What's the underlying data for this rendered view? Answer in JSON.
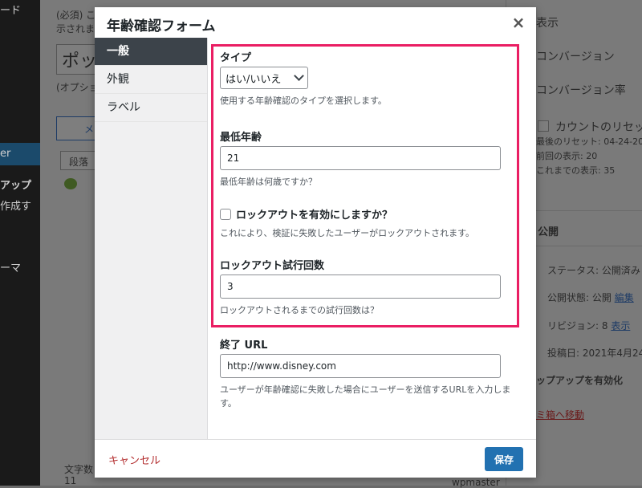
{
  "background": {
    "sidebar": {
      "text_top": "ード",
      "item_active": "er",
      "item_popup": "アップ",
      "item_create": "作成す",
      "item_theme": "ーマ"
    },
    "main": {
      "required_note": "(必須) こ",
      "required_note2": "示されま",
      "title_input_partial": "ポッ",
      "optional_note": "(オプショ",
      "media_button": "メ",
      "paragraph_label": "段落",
      "word_count_label": "文字数",
      "word_count_value": "11",
      "author": "wpmaster"
    },
    "right_panel": {
      "display": "表示",
      "conversion": "コンバージョン",
      "conversion_rate": "コンバージョン率",
      "reset_count": "カウントのリセッ",
      "last_reset": "最後のリセット: 04-24-20",
      "previous_display": "前回の表示: 20",
      "total_display": "これまでの表示: 35",
      "publish": "公開",
      "status": "ステータス: 公開済み",
      "visibility_label": "公開状態: 公開",
      "edit_link": "編集",
      "revision": "リビジョン: 8",
      "revision_link": "表示",
      "post_date": "投稿日: 2021年4月24",
      "enable_popup": "ップアップを有効化",
      "trash_link": "ミ箱へ移動"
    }
  },
  "modal": {
    "title": "年齢確認フォーム",
    "close_glyph": "×",
    "nav": [
      "一般",
      "外観",
      "ラベル"
    ],
    "fields": {
      "type": {
        "label": "タイプ",
        "selected": "はい/いいえ",
        "help": "使用する年齢確認のタイプを選択します。"
      },
      "min_age": {
        "label": "最低年齢",
        "value": "21",
        "help": "最低年齢は何歳ですか？"
      },
      "lockout": {
        "label": "ロックアウトを有効にしますか？",
        "checked": false,
        "help": "これにより、検証に失敗したユーザーがロックアウトされます。"
      },
      "lockout_attempts": {
        "label": "ロックアウト試行回数",
        "value": "3",
        "help": "ロックアウトされるまでの試行回数は？"
      },
      "end_url": {
        "label": "終了 URL",
        "value": "http://www.disney.com",
        "help": "ユーザーが年齢確認に失敗した場合にユーザーを送信するURLを入力します。"
      }
    },
    "footer": {
      "cancel": "キャンセル",
      "save": "保存"
    }
  },
  "colors": {
    "highlight": "#ea1e63",
    "primary": "#2271b1",
    "cancel": "#b32d2e",
    "nav_active": "#3c434a"
  }
}
